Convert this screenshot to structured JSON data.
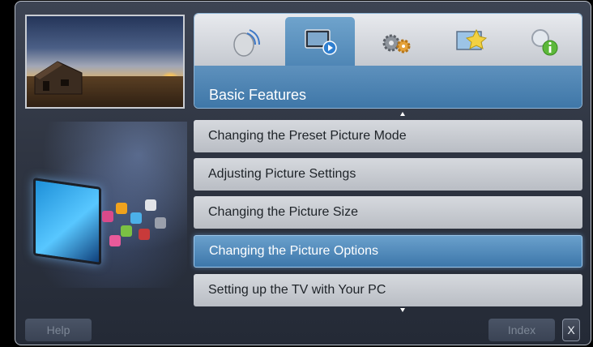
{
  "header": {
    "tabs": [
      {
        "icon": "satellite-dish-icon",
        "active": false
      },
      {
        "icon": "tv-screen-icon",
        "active": true
      },
      {
        "icon": "gears-icon",
        "active": false
      },
      {
        "icon": "tv-settings-icon",
        "active": false
      },
      {
        "icon": "search-info-icon",
        "active": false
      }
    ],
    "section_title": "Basic Features"
  },
  "menu": {
    "items": [
      {
        "label": "Changing the Preset Picture Mode",
        "selected": false
      },
      {
        "label": "Adjusting Picture Settings",
        "selected": false
      },
      {
        "label": "Changing the Picture Size",
        "selected": false
      },
      {
        "label": "Changing the Picture Options",
        "selected": true
      },
      {
        "label": "Setting up the TV with Your PC",
        "selected": false
      }
    ]
  },
  "footer": {
    "help_label": "Help",
    "index_label": "Index",
    "close_label": "X"
  },
  "colors": {
    "accent": "#4f86b5",
    "item_bg": "#c8ccd2",
    "frame_bg": "#2f3542"
  }
}
